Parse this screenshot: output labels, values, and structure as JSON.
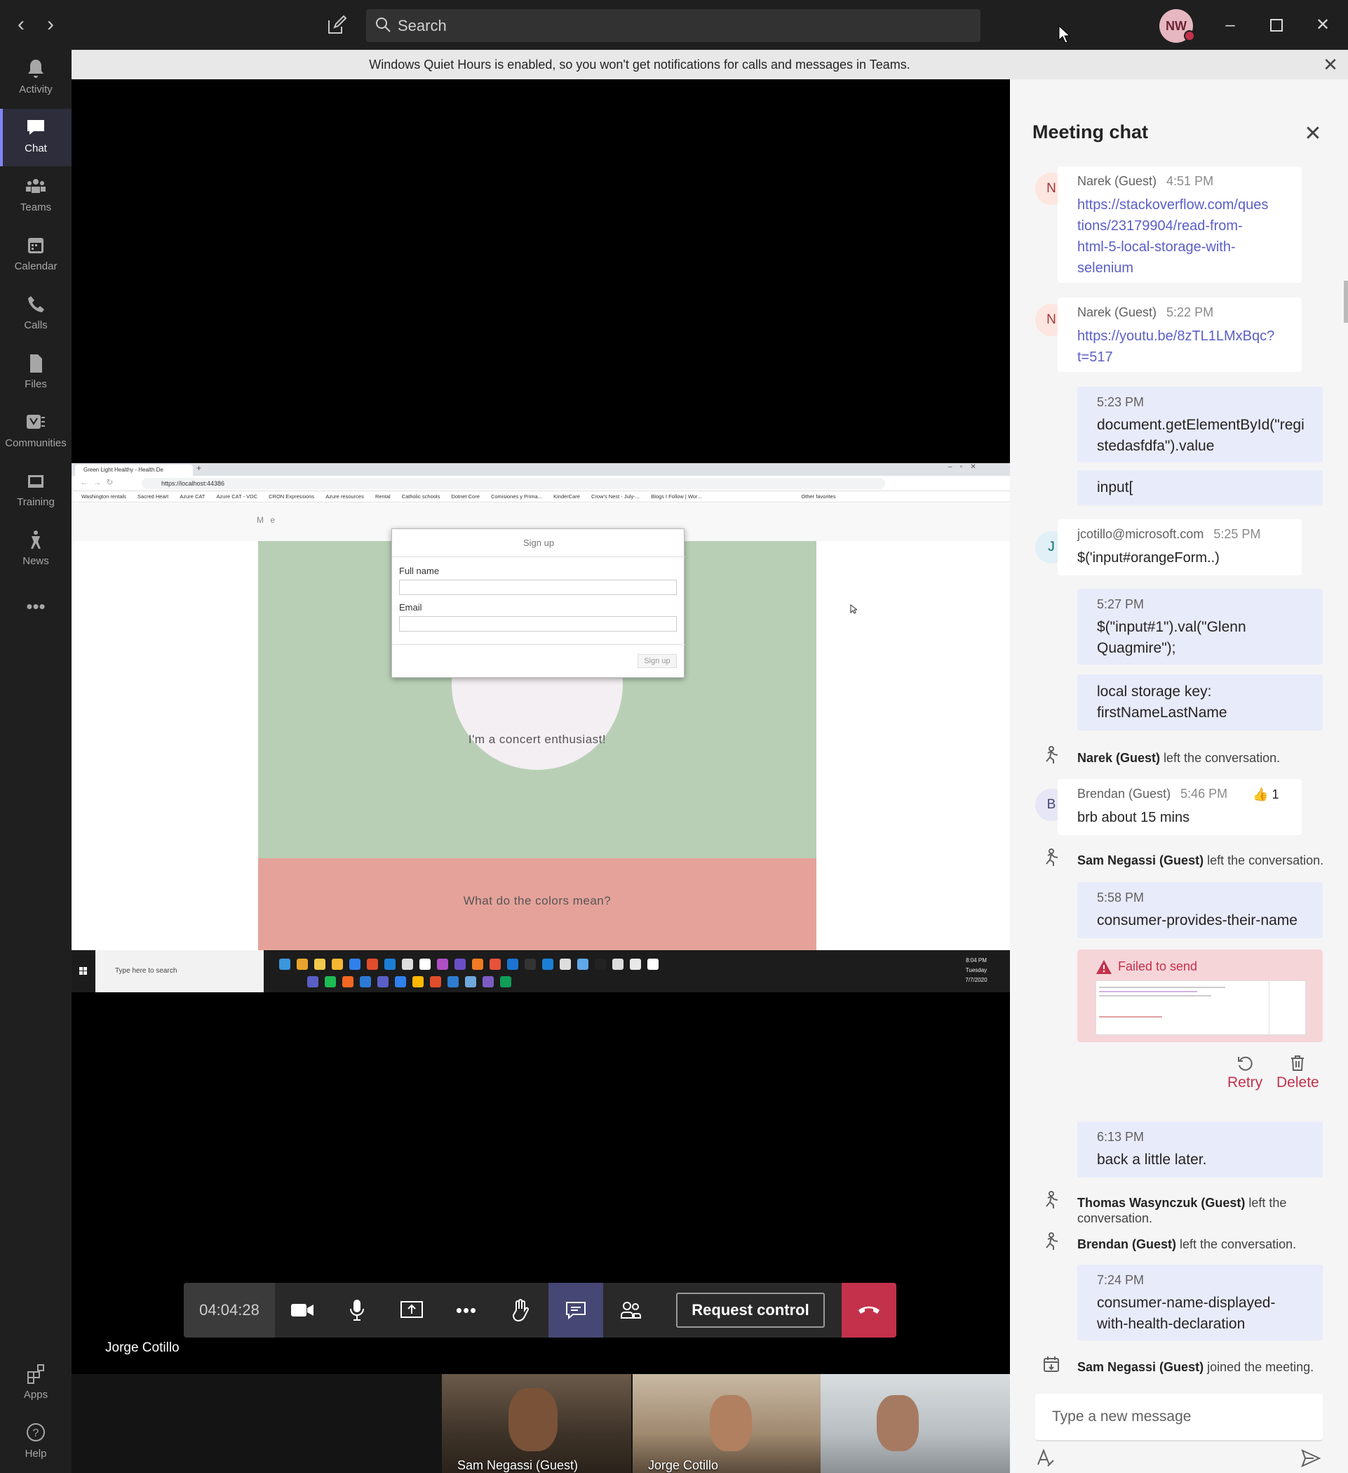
{
  "titlebar": {
    "search_placeholder": "Search",
    "avatar_initials": "NW"
  },
  "rail": [
    {
      "label": "Activity",
      "icon": "bell-icon"
    },
    {
      "label": "Chat",
      "icon": "chat-icon"
    },
    {
      "label": "Teams",
      "icon": "teams-icon"
    },
    {
      "label": "Calendar",
      "icon": "calendar-icon"
    },
    {
      "label": "Calls",
      "icon": "phone-icon"
    },
    {
      "label": "Files",
      "icon": "file-icon"
    },
    {
      "label": "Communities",
      "icon": "yammer-icon"
    },
    {
      "label": "Training",
      "icon": "training-icon"
    },
    {
      "label": "News",
      "icon": "news-icon"
    },
    {
      "label": "Apps",
      "icon": "apps-icon"
    },
    {
      "label": "Help",
      "icon": "help-icon"
    }
  ],
  "banner": {
    "text": "Windows Quiet Hours is enabled, so you won't get notifications for calls and messages in Teams."
  },
  "shared_screen": {
    "tab_title": "Green Light Healthy - Health De",
    "url": "https://localhost:44386",
    "bookmarks": [
      "Washington rentals",
      "Sacred Heart",
      "Azure CAT",
      "Azure CAT - VDC",
      "CRON Expressions",
      "Azure resources",
      "Rental",
      "Catholic schools",
      "Dotnet Core",
      "Comisiones y Prima...",
      "KinderCare",
      "Crow's Nest - July-...",
      "Blogs I Follow | Wor...",
      "Other favorites"
    ],
    "page_nav": "M e",
    "modal_title": "Sign up",
    "field_full_name": "Full name",
    "field_email": "Email",
    "modal_button": "Sign up",
    "tagline": "I'm a concert enthusiast!",
    "colors_question": "What do the colors mean?",
    "taskbar_search": "Type here to search",
    "clock_time": "8:04 PM",
    "clock_day": "Tuesday",
    "clock_date": "7/7/2020"
  },
  "call": {
    "timer": "04:04:28",
    "request_control": "Request control",
    "presenter": "Jorge Cotillo"
  },
  "thumbnails": [
    {
      "name": "Sam Negassi (Guest)"
    },
    {
      "name": "Jorge Cotillo"
    },
    {
      "name": ""
    }
  ],
  "chat": {
    "title": "Meeting chat",
    "m1": {
      "author": "Narek (Guest)",
      "time": "4:51 PM",
      "initial": "N",
      "lines": [
        "https://stackoverflow.com/ques",
        "tions/23179904/read-from-",
        "html-5-local-storage-with-",
        "selenium"
      ]
    },
    "m2": {
      "author": "Narek (Guest)",
      "time": "5:22 PM",
      "initial": "N",
      "lines": [
        "https://youtu.be/8zTL1LMxBqc?",
        "t=517"
      ]
    },
    "o1": {
      "time": "5:23 PM",
      "lines": [
        "document.getElementById(\"regi",
        "stedasfdfa\").value"
      ]
    },
    "o2": {
      "lines": [
        "input["
      ]
    },
    "m3": {
      "author": "jcotillo@microsoft.com",
      "time": "5:25 PM",
      "initial": "J",
      "lines": [
        "$('input#orangeForm..)"
      ]
    },
    "o3": {
      "time": "5:27 PM",
      "lines": [
        "$(\"input#1\").val(\"Glenn",
        "Quagmire\");"
      ]
    },
    "o4": {
      "lines": [
        "local storage key:",
        "firstNameLastName"
      ]
    },
    "s1": {
      "name": "Narek (Guest)",
      "text": " left the conversation."
    },
    "m4": {
      "author": "Brendan (Guest)",
      "time": "5:46 PM",
      "initial": "B",
      "lines": [
        "brb about 15 mins"
      ],
      "reaction": "1"
    },
    "s2": {
      "name": "Sam Negassi (Guest)",
      "text": " left the conversation."
    },
    "o5": {
      "time": "5:58 PM",
      "lines": [
        "consumer-provides-their-name"
      ]
    },
    "failed": {
      "text": "Failed to send"
    },
    "retry": "Retry",
    "delete": "Delete",
    "o6": {
      "time": "6:13 PM",
      "lines": [
        "back a little later."
      ]
    },
    "s3": {
      "name": "Thomas Wasynczuk (Guest)",
      "text": " left the conversation."
    },
    "s4": {
      "name": "Brendan (Guest)",
      "text": " left the conversation."
    },
    "o7": {
      "time": "7:24 PM",
      "lines": [
        "consumer-name-displayed-",
        "with-health-declaration"
      ]
    },
    "s5": {
      "name": "Sam Negassi (Guest)",
      "text": " joined the meeting."
    },
    "compose_placeholder": "Type a new message"
  },
  "colors": {
    "accent": "#5b5fc7",
    "rail_active": "#7f85f5",
    "hangup": "#c4314b",
    "own_msg": "#e8ebfa",
    "failed_bg": "#f6d5d9"
  }
}
